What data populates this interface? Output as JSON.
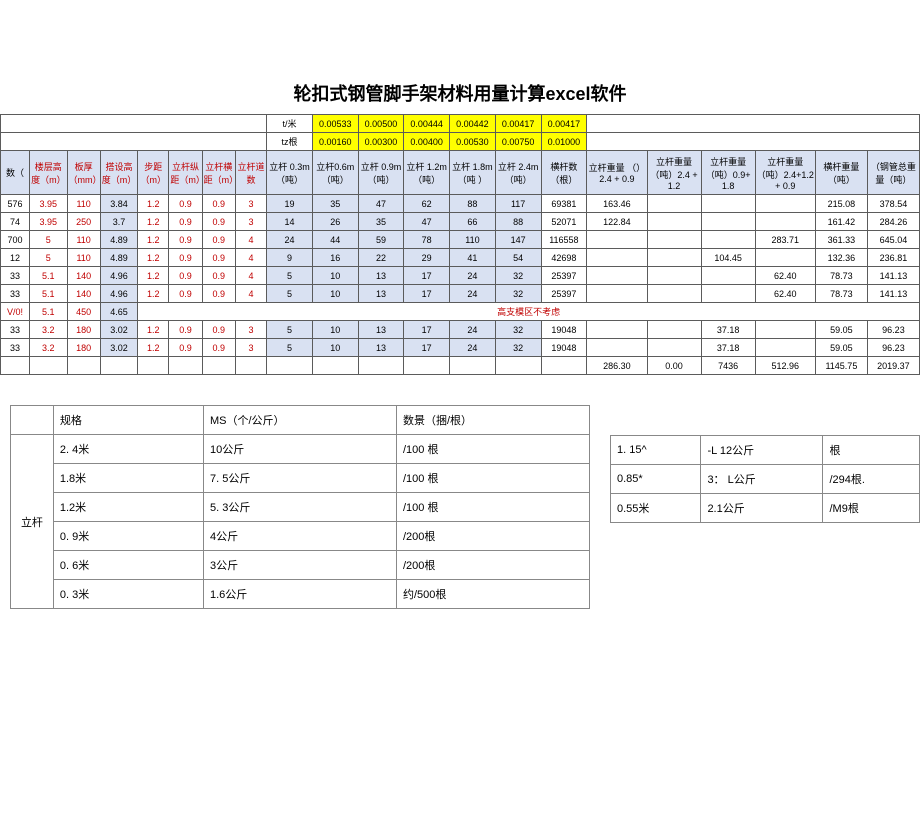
{
  "title": "轮扣式钢管脚手架材料用量计算excel软件",
  "topRows": {
    "labels": [
      "t/米",
      "tz根"
    ],
    "r1": [
      "0.00533",
      "0.00500",
      "0.00444",
      "0.00442",
      "0.00417",
      "0.00417"
    ],
    "r2": [
      "0.00160",
      "0.00300",
      "0.00400",
      "0.00530",
      "0.00750",
      "0.01000"
    ]
  },
  "headers": [
    "数（",
    "楼层高度（m）",
    "板厚（mm）",
    "搭设高度（m）",
    "步距（m）",
    "立杆纵距（m）",
    "立杆横距（m）",
    "立杆道数",
    "立杆 0.3m（吨）",
    "立杆0.6m（吨）",
    "立杆 0.9m（吨）",
    "立杆 1.2m（吨）",
    "立杆 1.8m（吨 ）",
    "立杆 2.4m（吨）",
    "横杆数（根）",
    "立杆重量 （）2.4 + 0.9",
    "立杆重量（吨）2.4 + 1.2",
    "立杆重量（吨）0.9+1.8",
    "立杆重量 （吨）2.4+1.2 + 0.9",
    "横杆重量（吨）",
    "（钢管总重量（吨）"
  ],
  "rows": [
    {
      "c": [
        "576",
        "3.95",
        "110",
        "3.84",
        "1.2",
        "0.9",
        "0.9",
        "3",
        "19",
        "35",
        "47",
        "62",
        "88",
        "117",
        "69381",
        "163.46",
        "",
        "",
        "",
        "215.08",
        "378.54"
      ]
    },
    {
      "c": [
        "74",
        "3.95",
        "250",
        "3.7",
        "1.2",
        "0.9",
        "0.9",
        "3",
        "14",
        "26",
        "35",
        "47",
        "66",
        "88",
        "52071",
        "122.84",
        "",
        "",
        "",
        "161.42",
        "284.26"
      ]
    },
    {
      "c": [
        "700",
        "5",
        "110",
        "4.89",
        "1.2",
        "0.9",
        "0.9",
        "4",
        "24",
        "44",
        "59",
        "78",
        "110",
        "147",
        "116558",
        "",
        "",
        "",
        "283.71",
        "361.33",
        "645.04"
      ]
    },
    {
      "c": [
        "12",
        "5",
        "110",
        "4.89",
        "1.2",
        "0.9",
        "0.9",
        "4",
        "9",
        "16",
        "22",
        "29",
        "41",
        "54",
        "42698",
        "",
        "",
        "104.45",
        "",
        "132.36",
        "236.81"
      ]
    },
    {
      "c": [
        "33",
        "5.1",
        "140",
        "4.96",
        "1.2",
        "0.9",
        "0.9",
        "4",
        "5",
        "10",
        "13",
        "17",
        "24",
        "32",
        "25397",
        "",
        "",
        "",
        "62.40",
        "78.73",
        "141.13"
      ]
    },
    {
      "c": [
        "33",
        "5.1",
        "140",
        "4.96",
        "1.2",
        "0.9",
        "0.9",
        "4",
        "5",
        "10",
        "13",
        "17",
        "24",
        "32",
        "25397",
        "",
        "",
        "",
        "62.40",
        "78.73",
        "141.13"
      ]
    }
  ],
  "noteRow": {
    "c0": "V/0!",
    "c1": "5.1",
    "c2": "450",
    "c3": "4.65",
    "note": "高支模区不考虑"
  },
  "rows2": [
    {
      "c": [
        "33",
        "3.2",
        "180",
        "3.02",
        "1.2",
        "0.9",
        "0.9",
        "3",
        "5",
        "10",
        "13",
        "17",
        "24",
        "32",
        "19048",
        "",
        "",
        "37.18",
        "",
        "59.05",
        "96.23"
      ]
    },
    {
      "c": [
        "33",
        "3.2",
        "180",
        "3.02",
        "1.2",
        "0.9",
        "0.9",
        "3",
        "5",
        "10",
        "13",
        "17",
        "24",
        "32",
        "19048",
        "",
        "",
        "37.18",
        "",
        "59.05",
        "96.23"
      ]
    }
  ],
  "totals": [
    "",
    "",
    "",
    "",
    "",
    "",
    "",
    "",
    "",
    "",
    "",
    "",
    "",
    "",
    "",
    "286.30",
    "0.00",
    "7436",
    "512.96",
    "1145.75",
    "2019.37"
  ],
  "smallTable": {
    "headers": [
      "",
      "规格",
      "MS（个/公斤）",
      "数景（捆/根）"
    ],
    "rowLabel": "立杆",
    "rows": [
      [
        "2. 4米",
        "10公斤",
        "/100 根"
      ],
      [
        "1.8米",
        "7. 5公斤",
        "/100 根"
      ],
      [
        "1.2米",
        "5. 3公斤",
        "/100 根"
      ],
      [
        "0. 9米",
        "4公斤",
        "/200根"
      ],
      [
        "0. 6米",
        "3公斤",
        "/200根"
      ],
      [
        "0. 3米",
        "1.6公斤",
        "约/500根"
      ]
    ]
  },
  "smallTable2": {
    "rows": [
      [
        "1. 15^",
        "-L 12公斤",
        "根"
      ],
      [
        "0.85*",
        "3： L公斤",
        "/294根."
      ],
      [
        "0.55米",
        "2.1公斤",
        "/M9根"
      ]
    ]
  }
}
